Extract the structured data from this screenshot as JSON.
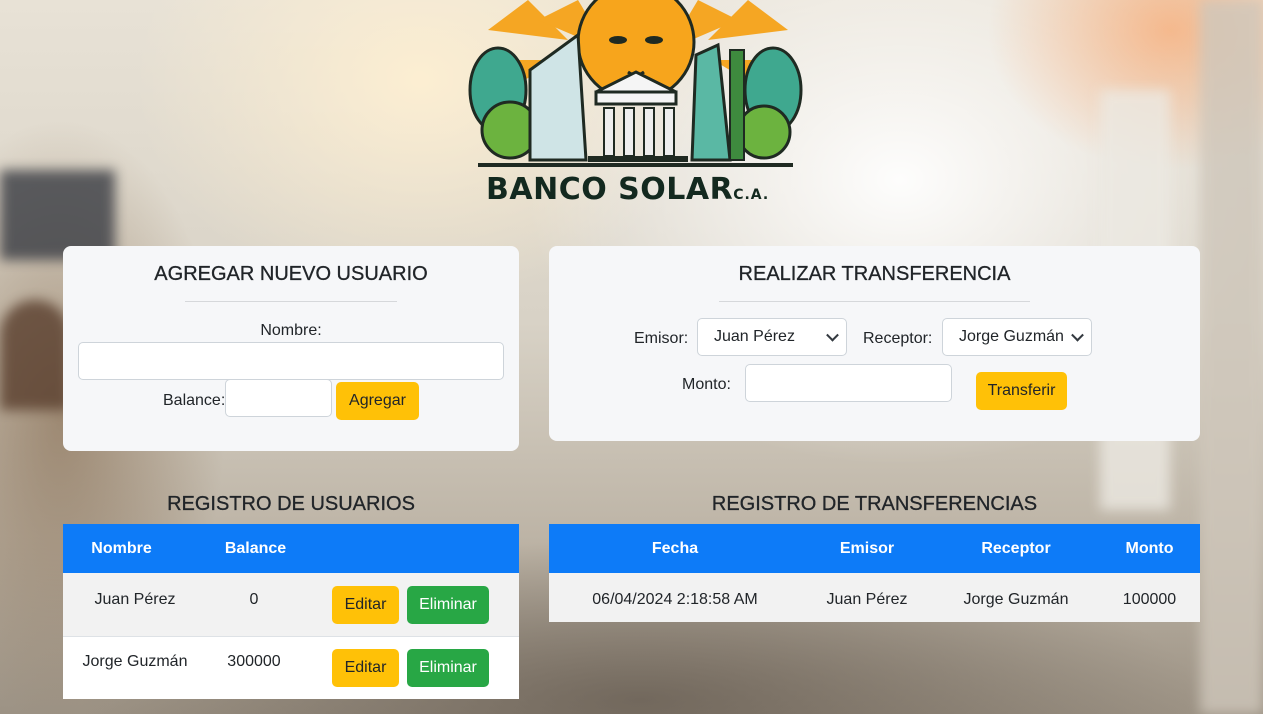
{
  "brand": {
    "name": "BANCO SOLAR",
    "suffix": "C.A."
  },
  "add_user": {
    "title": "AGREGAR NUEVO USUARIO",
    "name_label": "Nombre:",
    "name_value": "",
    "balance_label": "Balance:",
    "balance_value": "",
    "submit_label": "Agregar"
  },
  "transfer": {
    "title": "REALIZAR TRANSFERENCIA",
    "sender_label": "Emisor:",
    "sender_selected": "Juan Pérez",
    "receiver_label": "Receptor:",
    "receiver_selected": "Jorge Guzmán",
    "amount_label": "Monto:",
    "amount_value": "",
    "submit_label": "Transferir"
  },
  "users_table": {
    "title": "REGISTRO DE USUARIOS",
    "columns": [
      "Nombre",
      "Balance",
      ""
    ],
    "rows": [
      {
        "name": "Juan Pérez",
        "balance": "0",
        "edit_label": "Editar",
        "delete_label": "Eliminar"
      },
      {
        "name": "Jorge Guzmán",
        "balance": "300000",
        "edit_label": "Editar",
        "delete_label": "Eliminar"
      }
    ]
  },
  "transfers_table": {
    "title": "REGISTRO DE TRANSFERENCIAS",
    "columns": [
      "Fecha",
      "Emisor",
      "Receptor",
      "Monto"
    ],
    "rows": [
      {
        "date": "06/04/2024 2:18:58 AM",
        "sender": "Juan Pérez",
        "receiver": "Jorge Guzmán",
        "amount": "100000"
      }
    ]
  },
  "colors": {
    "primary": "#0d7bf8",
    "warning": "#ffc107",
    "success": "#28a745",
    "card": "#f6f7f9"
  }
}
